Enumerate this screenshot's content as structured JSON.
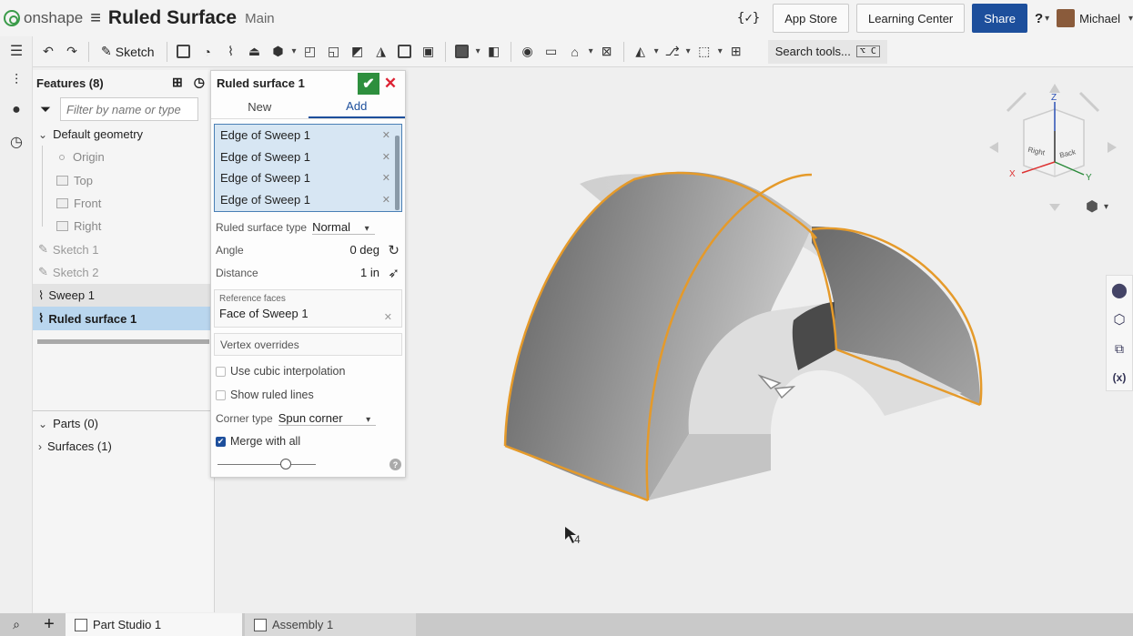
{
  "app": {
    "logo_text": "onshape",
    "doc_title": "Ruled Surface",
    "branch": "Main",
    "variable_btn": "{✓}",
    "app_store": "App Store",
    "learning_center": "Learning Center",
    "share": "Share",
    "help": "?",
    "user": "Michael"
  },
  "toolbar": {
    "sketch_label": "Sketch",
    "search_label": "Search tools...",
    "search_shortcut": "⌥ C"
  },
  "features": {
    "header": "Features (8)",
    "filter_placeholder": "Filter by name or type",
    "default_geometry": "Default geometry",
    "origin": "Origin",
    "planes": [
      "Top",
      "Front",
      "Right"
    ],
    "sketches": [
      "Sketch 1",
      "Sketch 2"
    ],
    "sweep": "Sweep 1",
    "ruled": "Ruled surface 1",
    "parts": "Parts (0)",
    "surfaces": "Surfaces (1)"
  },
  "dialog": {
    "title": "Ruled surface 1",
    "tab_new": "New",
    "tab_add": "Add",
    "edges": [
      "Edge of Sweep 1",
      "Edge of Sweep 1",
      "Edge of Sweep 1",
      "Edge of Sweep 1"
    ],
    "ruled_type_label": "Ruled surface type",
    "ruled_type_value": "Normal",
    "angle_label": "Angle",
    "angle_value": "0 deg",
    "distance_label": "Distance",
    "distance_value": "1 in",
    "reference_label": "Reference faces",
    "reference_value": "Face of Sweep 1",
    "vertex_overrides": "Vertex overrides",
    "cubic_label": "Use cubic interpolation",
    "cubic_checked": false,
    "show_lines_label": "Show ruled lines",
    "show_lines_checked": false,
    "corner_type_label": "Corner type",
    "corner_type_value": "Spun corner",
    "merge_label": "Merge with all",
    "merge_checked": true,
    "help": "?"
  },
  "viewcube": {
    "z": "Z",
    "x": "X",
    "y": "Y",
    "right": "Right",
    "back": "Back"
  },
  "cursor_count": "4",
  "tabs": {
    "part_studio": "Part Studio 1",
    "assembly": "Assembly 1"
  },
  "colors": {
    "accent": "#1d4f9c",
    "confirm": "#2e8f3e",
    "selected_row": "#b9d6ee",
    "highlight_edge": "#e59a2a"
  }
}
